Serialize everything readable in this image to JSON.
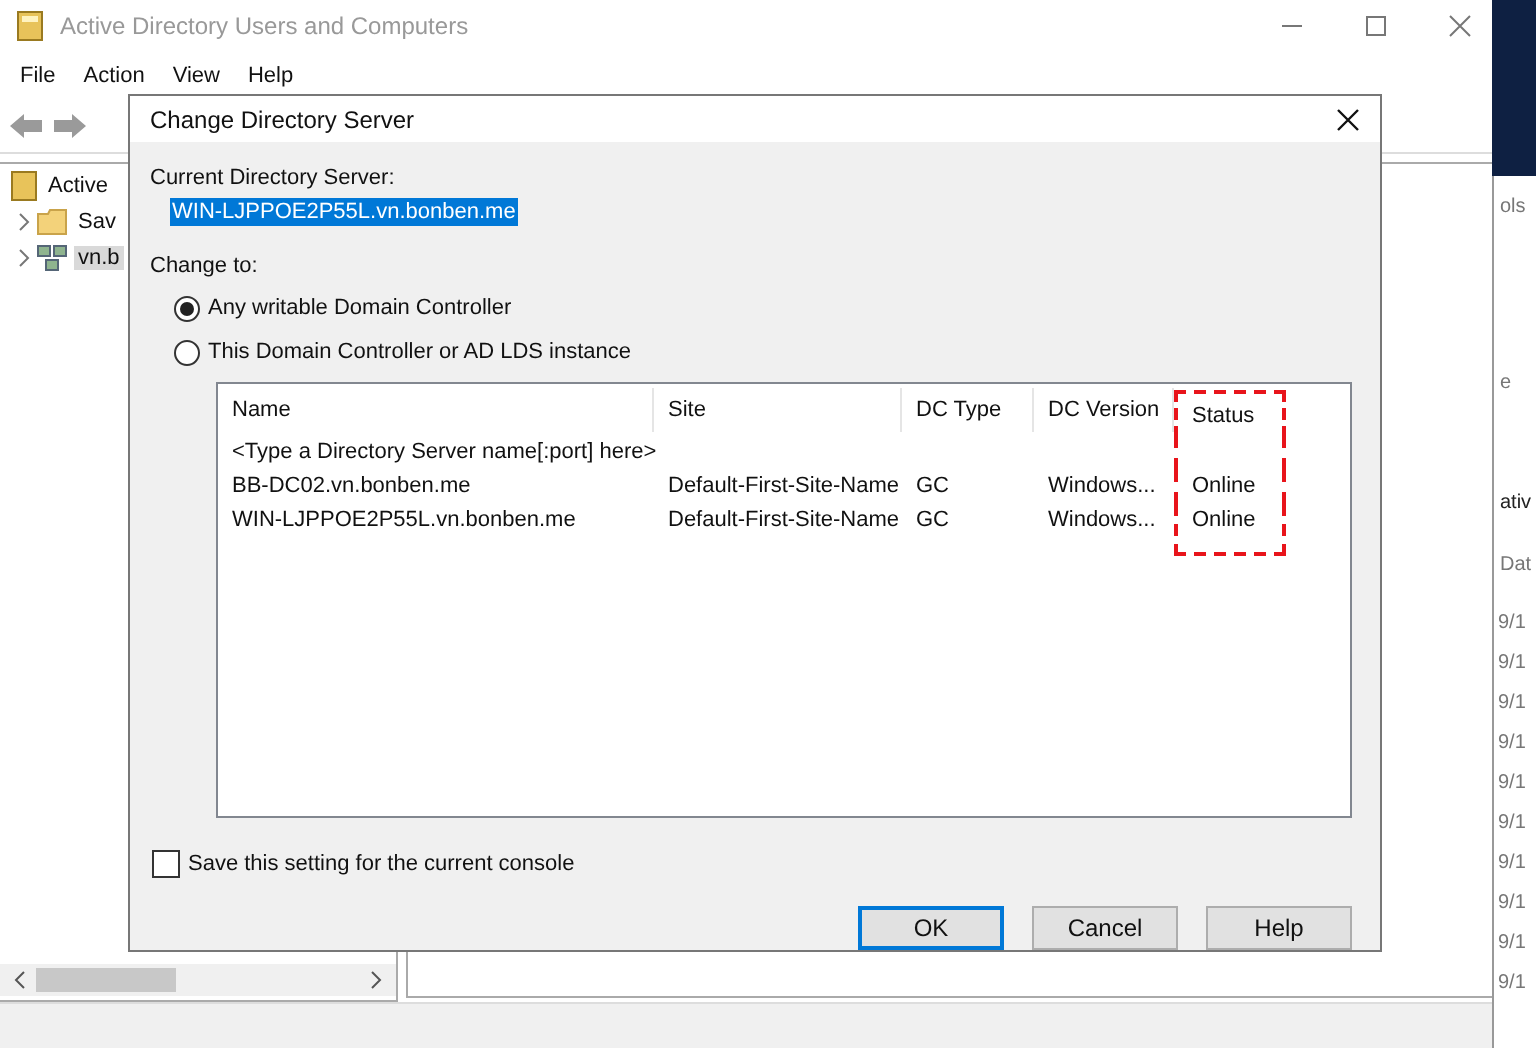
{
  "window": {
    "title": "Active Directory Users and Computers"
  },
  "menu": [
    "File",
    "Action",
    "View",
    "Help"
  ],
  "tree": {
    "label": "Active",
    "children": [
      {
        "label": "Sav",
        "kind": "folder",
        "selected": false
      },
      {
        "label": "vn.b",
        "kind": "domain",
        "selected": true
      }
    ]
  },
  "side_window": {
    "texts": [
      "ols",
      "e",
      "ativ",
      "Dat"
    ],
    "rows": [
      "9/1",
      "9/1",
      "9/1",
      "9/1",
      "9/1",
      "9/1",
      "9/1",
      "9/1",
      "9/1",
      "9/1"
    ]
  },
  "dialog": {
    "title": "Change Directory Server",
    "current_label": "Current Directory Server:",
    "current_value": "WIN-LJPPOE2P55L.vn.bonben.me",
    "change_label": "Change to:",
    "options": [
      {
        "label": "Any writable Domain Controller",
        "selected": true
      },
      {
        "label": "This Domain Controller or AD LDS instance",
        "selected": false
      }
    ],
    "columns": [
      {
        "label": "Name",
        "highlighted": false
      },
      {
        "label": "Site",
        "highlighted": false
      },
      {
        "label": "DC Type",
        "highlighted": false
      },
      {
        "label": "DC Version",
        "highlighted": false
      },
      {
        "label": "Status",
        "highlighted": true
      }
    ],
    "rows": [
      {
        "cells": [
          "<Type a Directory Server name[:port] here>"
        ]
      },
      {
        "cells": [
          "BB-DC02.vn.bonben.me",
          "Default-First-Site-Name",
          "GC",
          "Windows...",
          "Online"
        ]
      },
      {
        "cells": [
          "WIN-LJPPOE2P55L.vn.bonben.me",
          "Default-First-Site-Name",
          "GC",
          "Windows...",
          "Online"
        ]
      }
    ],
    "save_setting": {
      "label": "Save this setting for the current console",
      "checked": false
    },
    "buttons": [
      "OK",
      "Cancel",
      "Help"
    ]
  }
}
